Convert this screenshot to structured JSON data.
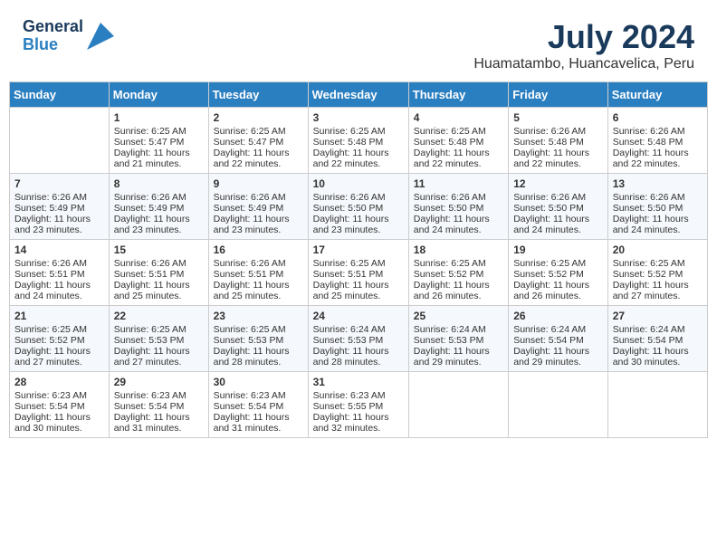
{
  "header": {
    "logo_general": "General",
    "logo_blue": "Blue",
    "month_year": "July 2024",
    "location": "Huamatambo, Huancavelica, Peru"
  },
  "weekdays": [
    "Sunday",
    "Monday",
    "Tuesday",
    "Wednesday",
    "Thursday",
    "Friday",
    "Saturday"
  ],
  "weeks": [
    [
      {
        "day": "",
        "content": ""
      },
      {
        "day": "1",
        "content": "Sunrise: 6:25 AM\nSunset: 5:47 PM\nDaylight: 11 hours and 21 minutes."
      },
      {
        "day": "2",
        "content": "Sunrise: 6:25 AM\nSunset: 5:47 PM\nDaylight: 11 hours and 22 minutes."
      },
      {
        "day": "3",
        "content": "Sunrise: 6:25 AM\nSunset: 5:48 PM\nDaylight: 11 hours and 22 minutes."
      },
      {
        "day": "4",
        "content": "Sunrise: 6:25 AM\nSunset: 5:48 PM\nDaylight: 11 hours and 22 minutes."
      },
      {
        "day": "5",
        "content": "Sunrise: 6:26 AM\nSunset: 5:48 PM\nDaylight: 11 hours and 22 minutes."
      },
      {
        "day": "6",
        "content": "Sunrise: 6:26 AM\nSunset: 5:48 PM\nDaylight: 11 hours and 22 minutes."
      }
    ],
    [
      {
        "day": "7",
        "content": "Sunrise: 6:26 AM\nSunset: 5:49 PM\nDaylight: 11 hours and 23 minutes."
      },
      {
        "day": "8",
        "content": "Sunrise: 6:26 AM\nSunset: 5:49 PM\nDaylight: 11 hours and 23 minutes."
      },
      {
        "day": "9",
        "content": "Sunrise: 6:26 AM\nSunset: 5:49 PM\nDaylight: 11 hours and 23 minutes."
      },
      {
        "day": "10",
        "content": "Sunrise: 6:26 AM\nSunset: 5:50 PM\nDaylight: 11 hours and 23 minutes."
      },
      {
        "day": "11",
        "content": "Sunrise: 6:26 AM\nSunset: 5:50 PM\nDaylight: 11 hours and 24 minutes."
      },
      {
        "day": "12",
        "content": "Sunrise: 6:26 AM\nSunset: 5:50 PM\nDaylight: 11 hours and 24 minutes."
      },
      {
        "day": "13",
        "content": "Sunrise: 6:26 AM\nSunset: 5:50 PM\nDaylight: 11 hours and 24 minutes."
      }
    ],
    [
      {
        "day": "14",
        "content": "Sunrise: 6:26 AM\nSunset: 5:51 PM\nDaylight: 11 hours and 24 minutes."
      },
      {
        "day": "15",
        "content": "Sunrise: 6:26 AM\nSunset: 5:51 PM\nDaylight: 11 hours and 25 minutes."
      },
      {
        "day": "16",
        "content": "Sunrise: 6:26 AM\nSunset: 5:51 PM\nDaylight: 11 hours and 25 minutes."
      },
      {
        "day": "17",
        "content": "Sunrise: 6:25 AM\nSunset: 5:51 PM\nDaylight: 11 hours and 25 minutes."
      },
      {
        "day": "18",
        "content": "Sunrise: 6:25 AM\nSunset: 5:52 PM\nDaylight: 11 hours and 26 minutes."
      },
      {
        "day": "19",
        "content": "Sunrise: 6:25 AM\nSunset: 5:52 PM\nDaylight: 11 hours and 26 minutes."
      },
      {
        "day": "20",
        "content": "Sunrise: 6:25 AM\nSunset: 5:52 PM\nDaylight: 11 hours and 27 minutes."
      }
    ],
    [
      {
        "day": "21",
        "content": "Sunrise: 6:25 AM\nSunset: 5:52 PM\nDaylight: 11 hours and 27 minutes."
      },
      {
        "day": "22",
        "content": "Sunrise: 6:25 AM\nSunset: 5:53 PM\nDaylight: 11 hours and 27 minutes."
      },
      {
        "day": "23",
        "content": "Sunrise: 6:25 AM\nSunset: 5:53 PM\nDaylight: 11 hours and 28 minutes."
      },
      {
        "day": "24",
        "content": "Sunrise: 6:24 AM\nSunset: 5:53 PM\nDaylight: 11 hours and 28 minutes."
      },
      {
        "day": "25",
        "content": "Sunrise: 6:24 AM\nSunset: 5:53 PM\nDaylight: 11 hours and 29 minutes."
      },
      {
        "day": "26",
        "content": "Sunrise: 6:24 AM\nSunset: 5:54 PM\nDaylight: 11 hours and 29 minutes."
      },
      {
        "day": "27",
        "content": "Sunrise: 6:24 AM\nSunset: 5:54 PM\nDaylight: 11 hours and 30 minutes."
      }
    ],
    [
      {
        "day": "28",
        "content": "Sunrise: 6:23 AM\nSunset: 5:54 PM\nDaylight: 11 hours and 30 minutes."
      },
      {
        "day": "29",
        "content": "Sunrise: 6:23 AM\nSunset: 5:54 PM\nDaylight: 11 hours and 31 minutes."
      },
      {
        "day": "30",
        "content": "Sunrise: 6:23 AM\nSunset: 5:54 PM\nDaylight: 11 hours and 31 minutes."
      },
      {
        "day": "31",
        "content": "Sunrise: 6:23 AM\nSunset: 5:55 PM\nDaylight: 11 hours and 32 minutes."
      },
      {
        "day": "",
        "content": ""
      },
      {
        "day": "",
        "content": ""
      },
      {
        "day": "",
        "content": ""
      }
    ]
  ]
}
